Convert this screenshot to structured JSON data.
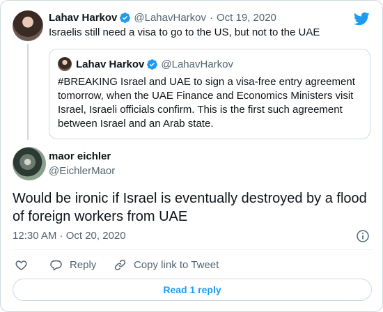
{
  "parent": {
    "name": "Lahav Harkov",
    "handle": "@LahavHarkov",
    "separator": "·",
    "date": "Oct 19, 2020",
    "text": "Israelis still need a visa to go to the US, but not to the UAE"
  },
  "quote": {
    "name": "Lahav Harkov",
    "handle": "@LahavHarkov",
    "text": "#BREAKING Israel and UAE to sign a visa-free entry agreement tomorrow, when the UAE Finance and Economics Ministers visit Israel, Israeli officials confirm. This is the first such agreement between Israel and an Arab state."
  },
  "main": {
    "name": "maor eichler",
    "handle": "@EichlerMaor",
    "text": "Would be ironic if Israel is eventually destroyed by a flood of foreign workers from UAE",
    "timestamp": "12:30 AM · Oct 20, 2020"
  },
  "actions": {
    "reply_label": "Reply",
    "copy_label": "Copy link to Tweet"
  },
  "read_replies_label": "Read 1 reply",
  "icons": {
    "brand": "twitter-bird-icon",
    "verified": "verified-badge-icon",
    "like": "heart-icon",
    "reply": "speech-bubble-icon",
    "copy": "link-icon",
    "info": "info-icon"
  },
  "colors": {
    "accent": "#1d9bf0",
    "text": "#0f1419",
    "muted": "#536471",
    "border": "#cfd9de"
  }
}
